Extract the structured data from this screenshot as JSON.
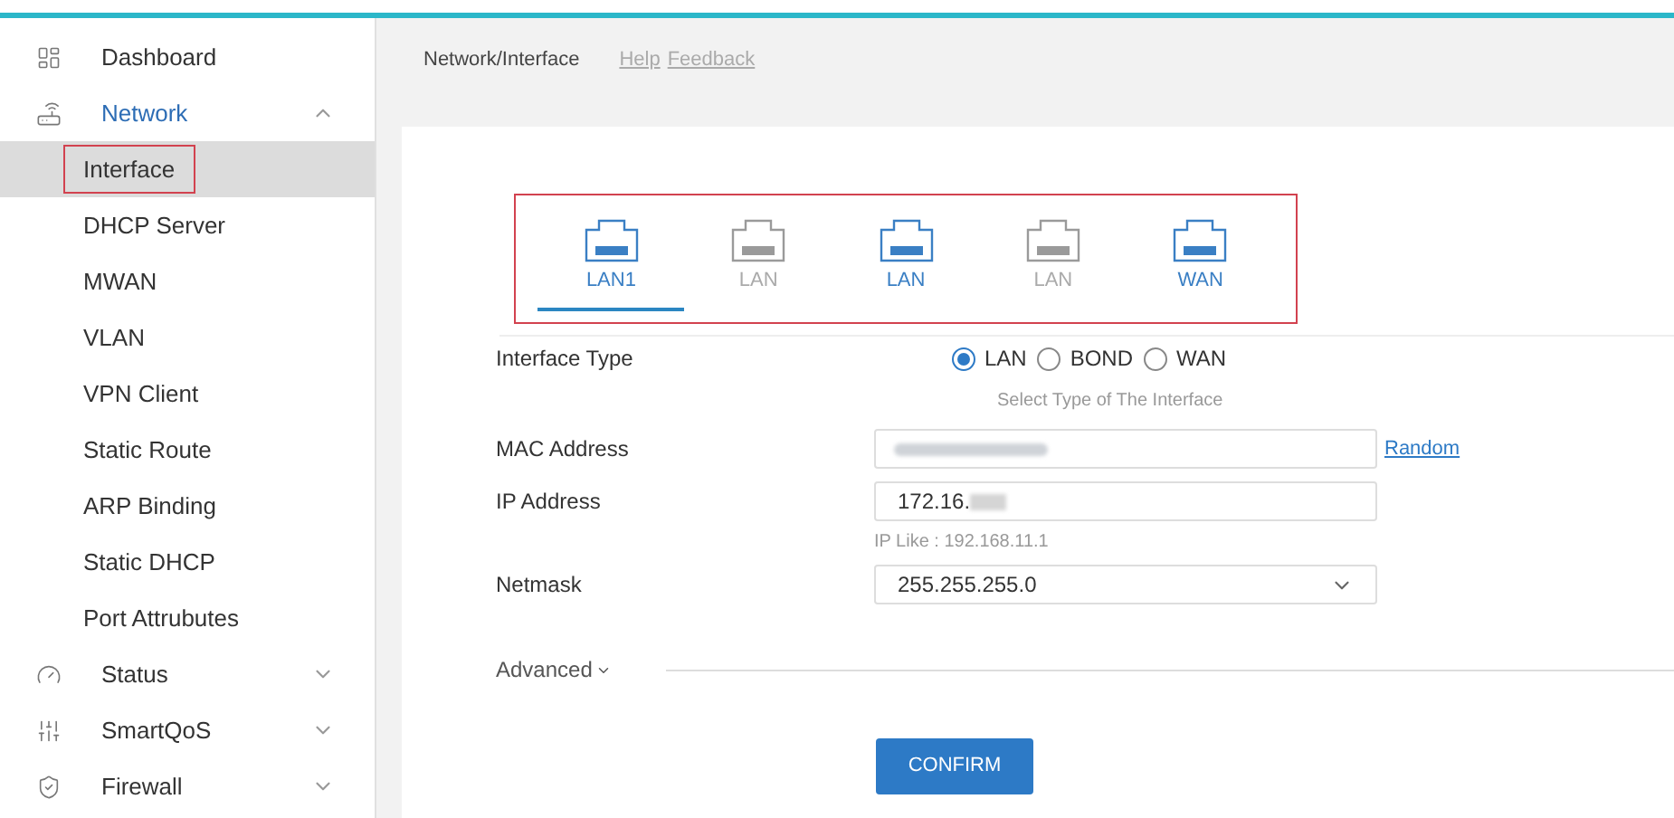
{
  "sidebar": {
    "items": [
      {
        "label": "Dashboard",
        "selected": false
      },
      {
        "label": "Network",
        "expanded": true,
        "selected": true,
        "children": [
          {
            "label": "Interface",
            "selected": true,
            "annotated": true
          },
          {
            "label": "DHCP Server",
            "selected": false,
            "annotated": false
          },
          {
            "label": "MWAN",
            "selected": false,
            "annotated": false
          },
          {
            "label": "VLAN",
            "selected": false,
            "annotated": false
          },
          {
            "label": "VPN Client",
            "selected": false,
            "annotated": false
          },
          {
            "label": "Static Route",
            "selected": false,
            "annotated": false
          },
          {
            "label": "ARP Binding",
            "selected": false,
            "annotated": false
          },
          {
            "label": "Static DHCP",
            "selected": false,
            "annotated": false
          },
          {
            "label": "Port Attrubutes",
            "selected": false,
            "annotated": false
          }
        ]
      },
      {
        "label": "Status",
        "expanded": false,
        "selected": false
      },
      {
        "label": "SmartQoS",
        "expanded": false,
        "selected": false
      },
      {
        "label": "Firewall",
        "expanded": false,
        "selected": false
      }
    ]
  },
  "header": {
    "breadcrumb": "Network/Interface",
    "links": [
      "Help",
      "Feedback"
    ]
  },
  "ports": {
    "annotated": true,
    "items": [
      {
        "label": "LAN1",
        "selected": true,
        "active": true
      },
      {
        "label": "LAN",
        "selected": false,
        "active": false
      },
      {
        "label": "LAN",
        "selected": false,
        "active": true
      },
      {
        "label": "LAN",
        "selected": false,
        "active": false
      },
      {
        "label": "WAN",
        "selected": false,
        "active": true
      }
    ]
  },
  "form": {
    "interface_type": {
      "label": "Interface Type",
      "options": [
        {
          "label": "LAN",
          "selected": true
        },
        {
          "label": "BOND",
          "selected": false
        },
        {
          "label": "WAN",
          "selected": false
        }
      ],
      "hint": "Select Type of The Interface"
    },
    "mac": {
      "label": "MAC Address",
      "action": "Random"
    },
    "ip": {
      "label": "IP Address",
      "value": "172.16.",
      "hint": "IP Like : 192.168.11.1"
    },
    "netmask": {
      "label": "Netmask",
      "value": "255.255.255.0"
    },
    "advanced": "Advanced",
    "confirm": "CONFIRM"
  }
}
